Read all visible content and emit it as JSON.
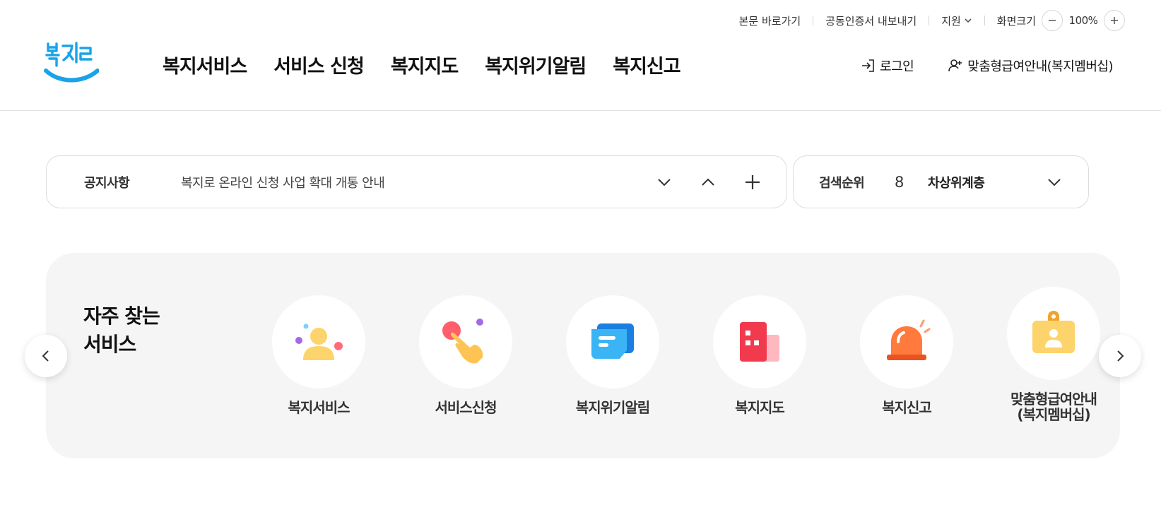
{
  "utility": {
    "skip_link": "본문 바로가기",
    "cert_export": "공동인증서 내보내기",
    "support": "지원",
    "zoom_label": "화면크기",
    "zoom_value": "100%"
  },
  "logo": {
    "alt": "복지로"
  },
  "nav": {
    "items": [
      "복지서비스",
      "서비스 신청",
      "복지지도",
      "복지위기알림",
      "복지신고"
    ]
  },
  "header_right": {
    "login": "로그인",
    "membership": "맞춤형급여안내(복지멤버십)"
  },
  "notice": {
    "label": "공지사항",
    "text": "복지로 온라인 신청 사업 확대 개통 안내"
  },
  "search_rank": {
    "label": "검색순위",
    "rank": "8",
    "term": "차상위계층"
  },
  "frequent": {
    "title_line1": "자주 찾는",
    "title_line2": "서비스",
    "items": [
      {
        "label": "복지서비스",
        "icon": "people-icon"
      },
      {
        "label": "서비스신청",
        "icon": "hand-tap-icon"
      },
      {
        "label": "복지위기알림",
        "icon": "message-icon"
      },
      {
        "label": "복지지도",
        "icon": "map-building-icon"
      },
      {
        "label": "복지신고",
        "icon": "siren-icon"
      },
      {
        "label": "맞춤형급여안내\n(복지멤버십)",
        "label_line1": "맞춤형급여안내",
        "label_line2": "(복지멤버십)",
        "icon": "id-badge-icon"
      }
    ]
  },
  "colors": {
    "brand_blue": "#1aa3e8",
    "panel_bg": "#f5f5f5",
    "border": "#dcdcdc"
  }
}
